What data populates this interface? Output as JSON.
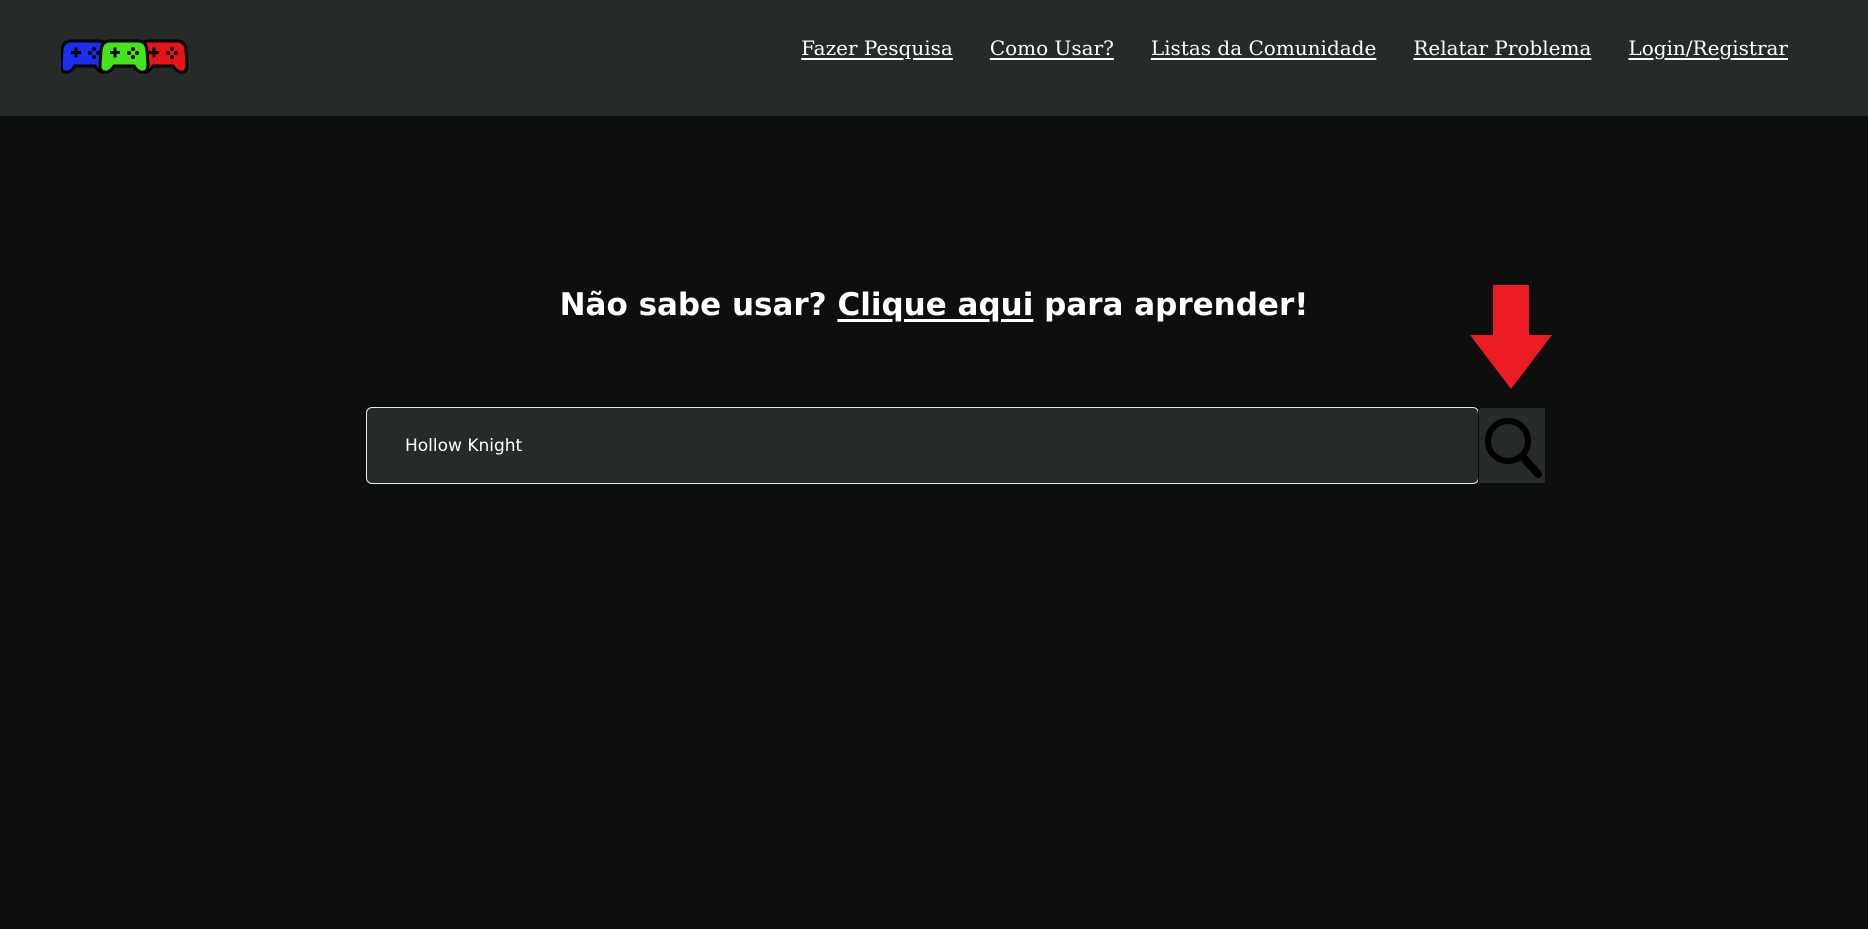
{
  "header": {
    "logo_icon": "three-gamepads-logo",
    "logo_colors": [
      "#1a2ef0",
      "#43e51b",
      "#e8141b"
    ],
    "nav": [
      {
        "label": "Fazer Pesquisa"
      },
      {
        "label": "Como Usar?"
      },
      {
        "label": "Listas da Comunidade"
      },
      {
        "label": "Relatar Problema"
      },
      {
        "label": "Login/Registrar"
      }
    ]
  },
  "main": {
    "help_prefix": "Não sabe usar?",
    "help_link": "Clique aqui",
    "help_suffix": "para aprender!",
    "search": {
      "value": "Hollow Knight",
      "button_icon": "magnifier-icon"
    },
    "annotation_arrow_color": "#ec1c24"
  },
  "colors": {
    "background": "#0d0e0e",
    "header_bg": "#262a28",
    "input_bg": "#262a28",
    "text": "#ffffff"
  }
}
